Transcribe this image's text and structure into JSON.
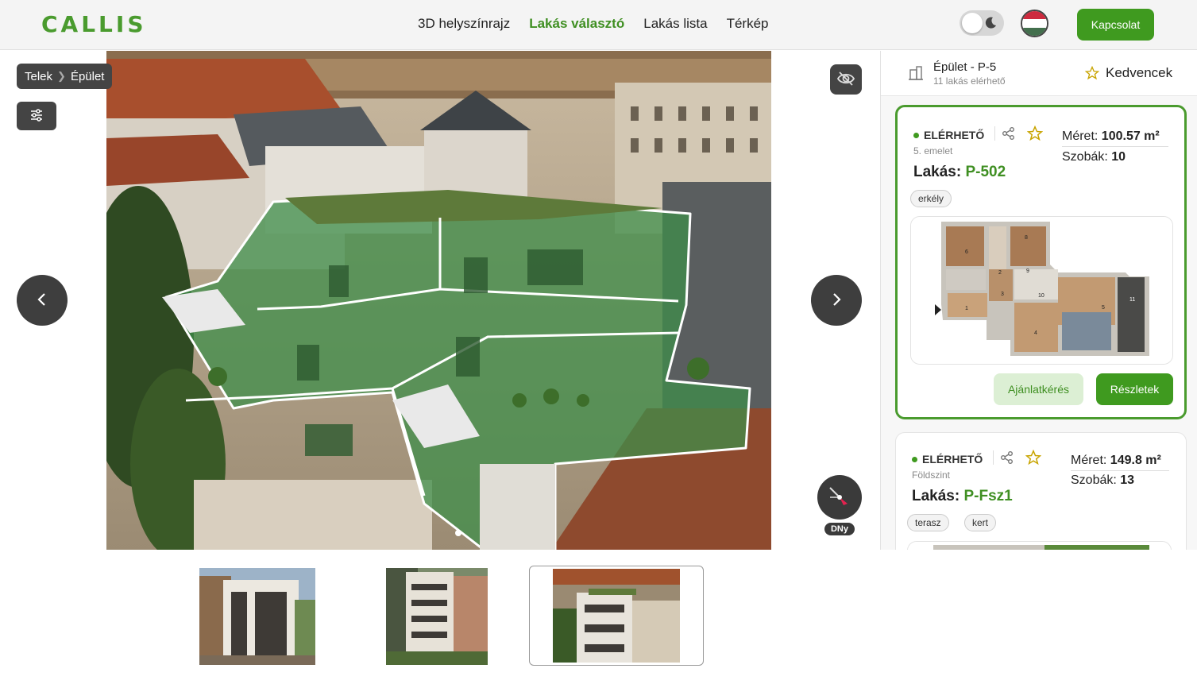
{
  "header": {
    "logo": "CALLIS",
    "nav": [
      "3D helyszínrajz",
      "Lakás választó",
      "Lakás lista",
      "Térkép"
    ],
    "active_nav": "Lakás választó",
    "contact_label": "Kapcsolat",
    "flag_colors": [
      "#cd2a3e",
      "#ffffff",
      "#436f4d"
    ]
  },
  "viewer": {
    "breadcrumb": [
      "Telek",
      "Épület"
    ],
    "compass_label": "DNy",
    "icons": [
      "filter-icon",
      "eye-off-icon",
      "chevron-left-icon",
      "chevron-right-icon",
      "compass-icon"
    ]
  },
  "thumbnails": [
    {
      "label": "",
      "selected": false
    },
    {
      "label": "",
      "selected": false
    },
    {
      "label": "",
      "selected": true
    }
  ],
  "panel": {
    "building_title": "Épület - P-5",
    "building_sub": "11 lakás elérhető",
    "favorites_label": "Kedvencek",
    "cards": [
      {
        "status": "ELÉRHETŐ",
        "floor": "5. emelet",
        "lakas_label": "Lakás:",
        "code": "P-502",
        "size_label": "Méret:",
        "size": "100.57 m²",
        "rooms_label": "Szobák:",
        "rooms": "10",
        "tags": [
          "erkély"
        ],
        "plan_numbers": [
          "1",
          "2",
          "3",
          "4",
          "5",
          "6",
          "8",
          "9",
          "10",
          "11"
        ],
        "offer_label": "Ajánlatkérés",
        "details_label": "Részletek"
      },
      {
        "status": "ELÉRHETŐ",
        "floor": "Földszint",
        "lakas_label": "Lakás:",
        "code": "P-Fsz1",
        "size_label": "Méret:",
        "size": "149.8 m²",
        "rooms_label": "Szobák:",
        "rooms": "13",
        "tags": [
          "terasz",
          "kert"
        ]
      }
    ]
  },
  "colors": {
    "brand_green": "#3f9a1f",
    "highlight_green": "#4a9b2e",
    "dark_button": "#3e3e3e"
  }
}
